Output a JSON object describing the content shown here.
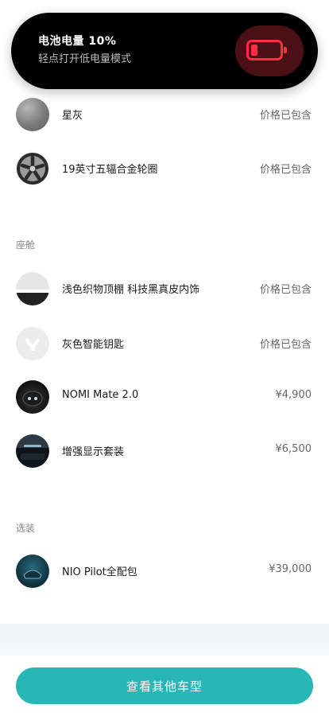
{
  "banner": {
    "title": "电池电量 10%",
    "subtitle": "轻点打开低电量模式",
    "icon": "battery-low-icon",
    "accent": "#ff2d44"
  },
  "sections": {
    "cabin_label": "座舱",
    "options_label": "选装"
  },
  "exterior_items": [
    {
      "name": "星灰",
      "price": "价格已包含",
      "icon": "color-swatch-gray"
    },
    {
      "name": "19英寸五辐合金轮圈",
      "price": "价格已包含",
      "icon": "wheel-rim"
    }
  ],
  "cabin_items": [
    {
      "name": "浅色织物顶棚 科技黑真皮内饰",
      "price": "价格已包含",
      "icon": "interior-swatch"
    },
    {
      "name": "灰色智能钥匙",
      "price": "价格已包含",
      "icon": "smart-key"
    },
    {
      "name": "NOMI Mate 2.0",
      "price": "¥4,900",
      "icon": "nomi-mate"
    },
    {
      "name": "增强显示套装",
      "price": "¥6,500",
      "icon": "display-kit"
    }
  ],
  "option_items": [
    {
      "name": "NIO Pilot全配包",
      "price": "¥39,000",
      "icon": "nio-pilot"
    }
  ],
  "cta": {
    "label": "查看其他车型",
    "color": "#29b6b6"
  }
}
